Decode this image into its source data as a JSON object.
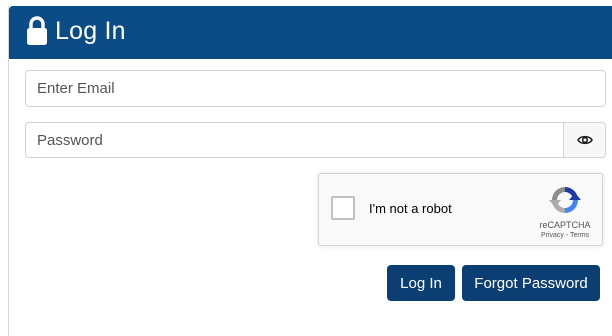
{
  "header": {
    "title": "Log In",
    "icon": "lock-icon",
    "color": "#0b4c86"
  },
  "form": {
    "email": {
      "placeholder": "Enter Email",
      "value": ""
    },
    "password": {
      "placeholder": "Password",
      "value": "",
      "toggle_icon": "eye-icon"
    }
  },
  "recaptcha": {
    "label": "I'm not a robot",
    "checked": false,
    "brand": "reCAPTCHA",
    "privacy_link": "Privacy",
    "separator": " - ",
    "terms_link": "Terms"
  },
  "buttons": {
    "login_label": "Log In",
    "forgot_label": "Forgot Password",
    "color": "#0b3f73"
  }
}
